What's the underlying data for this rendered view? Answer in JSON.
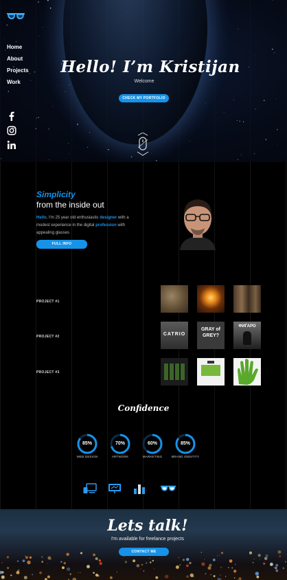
{
  "nav": {
    "items": [
      "Home",
      "About",
      "Projects",
      "Work"
    ]
  },
  "socials": [
    "facebook-icon",
    "instagram-icon",
    "linkedin-icon"
  ],
  "hero": {
    "title": "Hello! I’m Kristijan",
    "subtitle": "Welcome",
    "cta": "CHECK MY PORTFOLIO"
  },
  "about": {
    "heading_accent": "Simplicity",
    "heading": "from the inside out",
    "text_parts": [
      "Hello",
      ", I'm 25 year old enthusiastic ",
      "designer",
      " with a modest experience in the digital ",
      "profession",
      " with appealing glasses"
    ],
    "cta": "FULL INFO"
  },
  "projects": [
    {
      "label": "PROJECT #1",
      "thumbs": [
        "",
        "",
        ""
      ]
    },
    {
      "label": "PROJECT #2",
      "thumbs": [
        "CATRIO",
        "GRAY of GREY?",
        "ФИГАРО"
      ]
    },
    {
      "label": "PROJECT #3",
      "thumbs": [
        "",
        "",
        ""
      ]
    }
  ],
  "confidence": {
    "title": "Confidence",
    "skills": [
      {
        "value": "85%",
        "label": "WEB DESIGN",
        "percent": 85
      },
      {
        "value": "70%",
        "label": "ARTWORK",
        "percent": 70
      },
      {
        "value": "60%",
        "label": "MARKETING",
        "percent": 60
      },
      {
        "value": "85%",
        "label": "BRAND IDENTITY",
        "percent": 85
      }
    ],
    "icons": [
      "devices-icon",
      "presentation-icon",
      "bar-chart-icon",
      "glasses-icon"
    ]
  },
  "contact": {
    "title": "Lets talk!",
    "subtitle": "I'm available for freelance projects",
    "cta": "CONTACT ME"
  },
  "colors": {
    "accent": "#1693e8"
  }
}
